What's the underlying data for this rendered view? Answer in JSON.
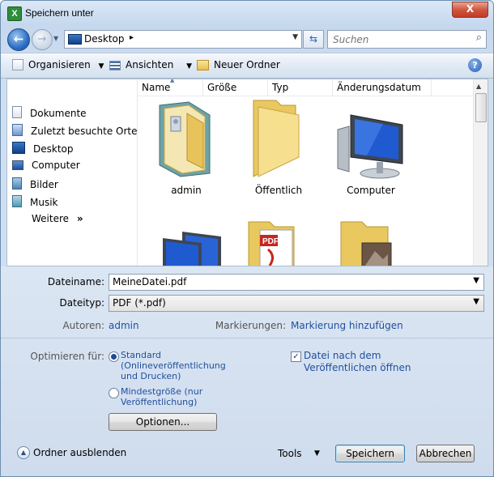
{
  "window": {
    "title": "Speichern unter",
    "app_icon": "excel-icon",
    "close_label": "X"
  },
  "nav": {
    "back_glyph": "←",
    "forward_glyph": "→",
    "location": "Desktop",
    "chevron": "▸",
    "dropdown": "▼",
    "refresh_glyph": "⇆",
    "search_placeholder": "Suchen",
    "search_glyph": "⌕"
  },
  "toolbar": {
    "organize": "Organisieren",
    "views": "Ansichten",
    "new_folder": "Neuer Ordner",
    "arrow": "▼",
    "help": "?"
  },
  "sidebar": {
    "items": [
      {
        "label": "Dokumente",
        "icon": "documents-icon"
      },
      {
        "label": "Zuletzt besuchte Orte",
        "icon": "recent-places-icon"
      },
      {
        "label": "Desktop",
        "icon": "desktop-icon"
      },
      {
        "label": "Computer",
        "icon": "computer-icon"
      },
      {
        "label": "Bilder",
        "icon": "pictures-icon"
      },
      {
        "label": "Musik",
        "icon": "music-icon"
      }
    ],
    "more": "Weitere",
    "more_glyph": "»"
  },
  "columns": [
    "Name",
    "Größe",
    "Typ",
    "Änderungsdatum"
  ],
  "files": [
    {
      "label": "admin",
      "icon": "user-folder-icon"
    },
    {
      "label": "Öffentlich",
      "icon": "folder-icon"
    },
    {
      "label": "Computer",
      "icon": "computer-icon"
    }
  ],
  "partial_files": [
    {
      "icon": "network-icon"
    },
    {
      "icon": "pdf-folder-icon",
      "badge": "PDF"
    },
    {
      "icon": "picture-folder-icon"
    }
  ],
  "form": {
    "filename_label": "Dateiname:",
    "filename_value": "MeineDatei.pdf",
    "filetype_label": "Dateityp:",
    "filetype_value": "PDF (*.pdf)",
    "authors_label": "Autoren:",
    "authors_value": "admin",
    "tags_label": "Markierungen:",
    "tags_value": "Markierung hinzufügen",
    "optimize_label": "Optimieren für:",
    "opt_standard_1": "Standard",
    "opt_standard_2": "(Onlineveröffentlichung",
    "opt_standard_3": "und Drucken)",
    "opt_min_1": "Mindestgröße (nur",
    "opt_min_2": "Veröffentlichung)",
    "open_after_1": "Datei nach dem",
    "open_after_2": "Veröffentlichen öffnen",
    "options_button": "Optionen...",
    "hide_folders": "Ordner ausblenden",
    "tools": "Tools",
    "save": "Speichern",
    "cancel": "Abbrechen"
  }
}
